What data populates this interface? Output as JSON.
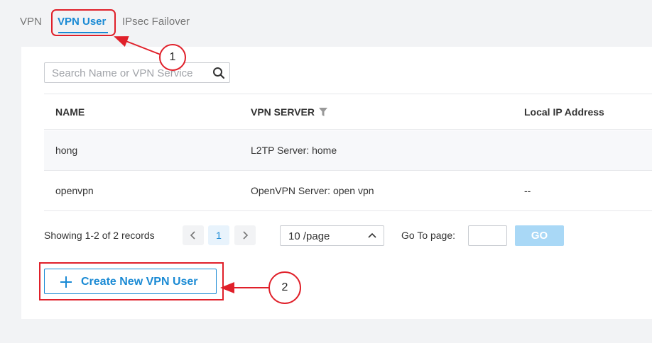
{
  "tabs": [
    {
      "label": "VPN"
    },
    {
      "label": "VPN User"
    },
    {
      "label": "IPsec Failover"
    }
  ],
  "search": {
    "placeholder": "Search Name or VPN Service",
    "icon": "search-icon"
  },
  "table": {
    "columns": [
      "NAME",
      "VPN SERVER",
      "Local IP Address"
    ],
    "rows": [
      {
        "name": "hong",
        "server": "L2TP Server: home",
        "local_ip": ""
      },
      {
        "name": "openvpn",
        "server": "OpenVPN Server: open vpn",
        "local_ip": "--"
      }
    ]
  },
  "pagination": {
    "summary": "Showing 1-2 of 2 records",
    "current_page": "1",
    "per_page": "10 /page",
    "goto_label": "Go To page:",
    "go_label": "GO"
  },
  "create_button": {
    "label": "Create New VPN User"
  },
  "callouts": [
    "1",
    "2"
  ],
  "colors": {
    "accent": "#1a8ad4",
    "annotation": "#e0202a",
    "go_disabled": "#a9d8f6"
  }
}
